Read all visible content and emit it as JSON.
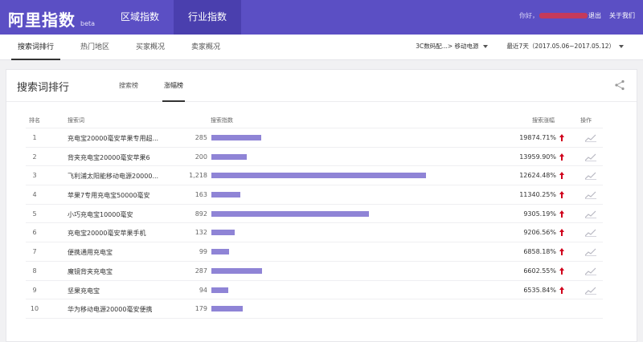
{
  "header": {
    "brand_title": "阿里指数",
    "brand_beta": "beta",
    "nav_tabs": [
      {
        "label": "区域指数",
        "active": false
      },
      {
        "label": "行业指数",
        "active": true
      }
    ],
    "greeting": "你好，",
    "logout_label": "退出",
    "about_label": "关于我们"
  },
  "subnav": {
    "tabs": [
      {
        "label": "搜索词排行",
        "active": true
      },
      {
        "label": "热门地区",
        "active": false
      },
      {
        "label": "买家概况",
        "active": false
      },
      {
        "label": "卖家概况",
        "active": false
      }
    ],
    "category_filter": "3C数码配...> 移动电源",
    "date_filter": "最近7天（2017.05.06~2017.05.12）"
  },
  "card": {
    "title": "搜索词排行",
    "tabs": [
      {
        "label": "搜索榜",
        "active": false
      },
      {
        "label": "涨幅榜",
        "active": true
      }
    ],
    "columns": {
      "rank": "排名",
      "keyword": "搜索词",
      "index": "搜索指数",
      "growth": "搜索涨幅",
      "op": "操作"
    },
    "index_max": 1218,
    "rows": [
      {
        "rank": "1",
        "keyword": "充电宝20000毫安苹果专用超...",
        "count": "285",
        "value": 285,
        "growth": "19874.71%"
      },
      {
        "rank": "2",
        "keyword": "背夹充电宝20000毫安苹果6",
        "count": "200",
        "value": 200,
        "growth": "13959.90%"
      },
      {
        "rank": "3",
        "keyword": "飞利浦太阳能移动电源20000...",
        "count": "1,218",
        "value": 1218,
        "growth": "12624.48%"
      },
      {
        "rank": "4",
        "keyword": "苹果7专用充电宝50000毫安",
        "count": "163",
        "value": 163,
        "growth": "11340.25%"
      },
      {
        "rank": "5",
        "keyword": "小巧充电宝10000毫安",
        "count": "892",
        "value": 892,
        "growth": "9305.19%"
      },
      {
        "rank": "6",
        "keyword": "充电宝20000毫安苹果手机",
        "count": "132",
        "value": 132,
        "growth": "9206.56%"
      },
      {
        "rank": "7",
        "keyword": "便携通用充电宝",
        "count": "99",
        "value": 99,
        "growth": "6858.18%"
      },
      {
        "rank": "8",
        "keyword": "魔镜背夹充电宝",
        "count": "287",
        "value": 287,
        "growth": "6602.55%"
      },
      {
        "rank": "9",
        "keyword": "坚果充电宝",
        "count": "94",
        "value": 94,
        "growth": "6535.84%"
      },
      {
        "rank": "10",
        "keyword": "华为移动电源20000毫安便携",
        "count": "179",
        "value": 179,
        "growth": ""
      }
    ]
  },
  "colors": {
    "brand": "#5b4fc4",
    "bar": "#8f84d6",
    "up_arrow": "#d0021b"
  }
}
